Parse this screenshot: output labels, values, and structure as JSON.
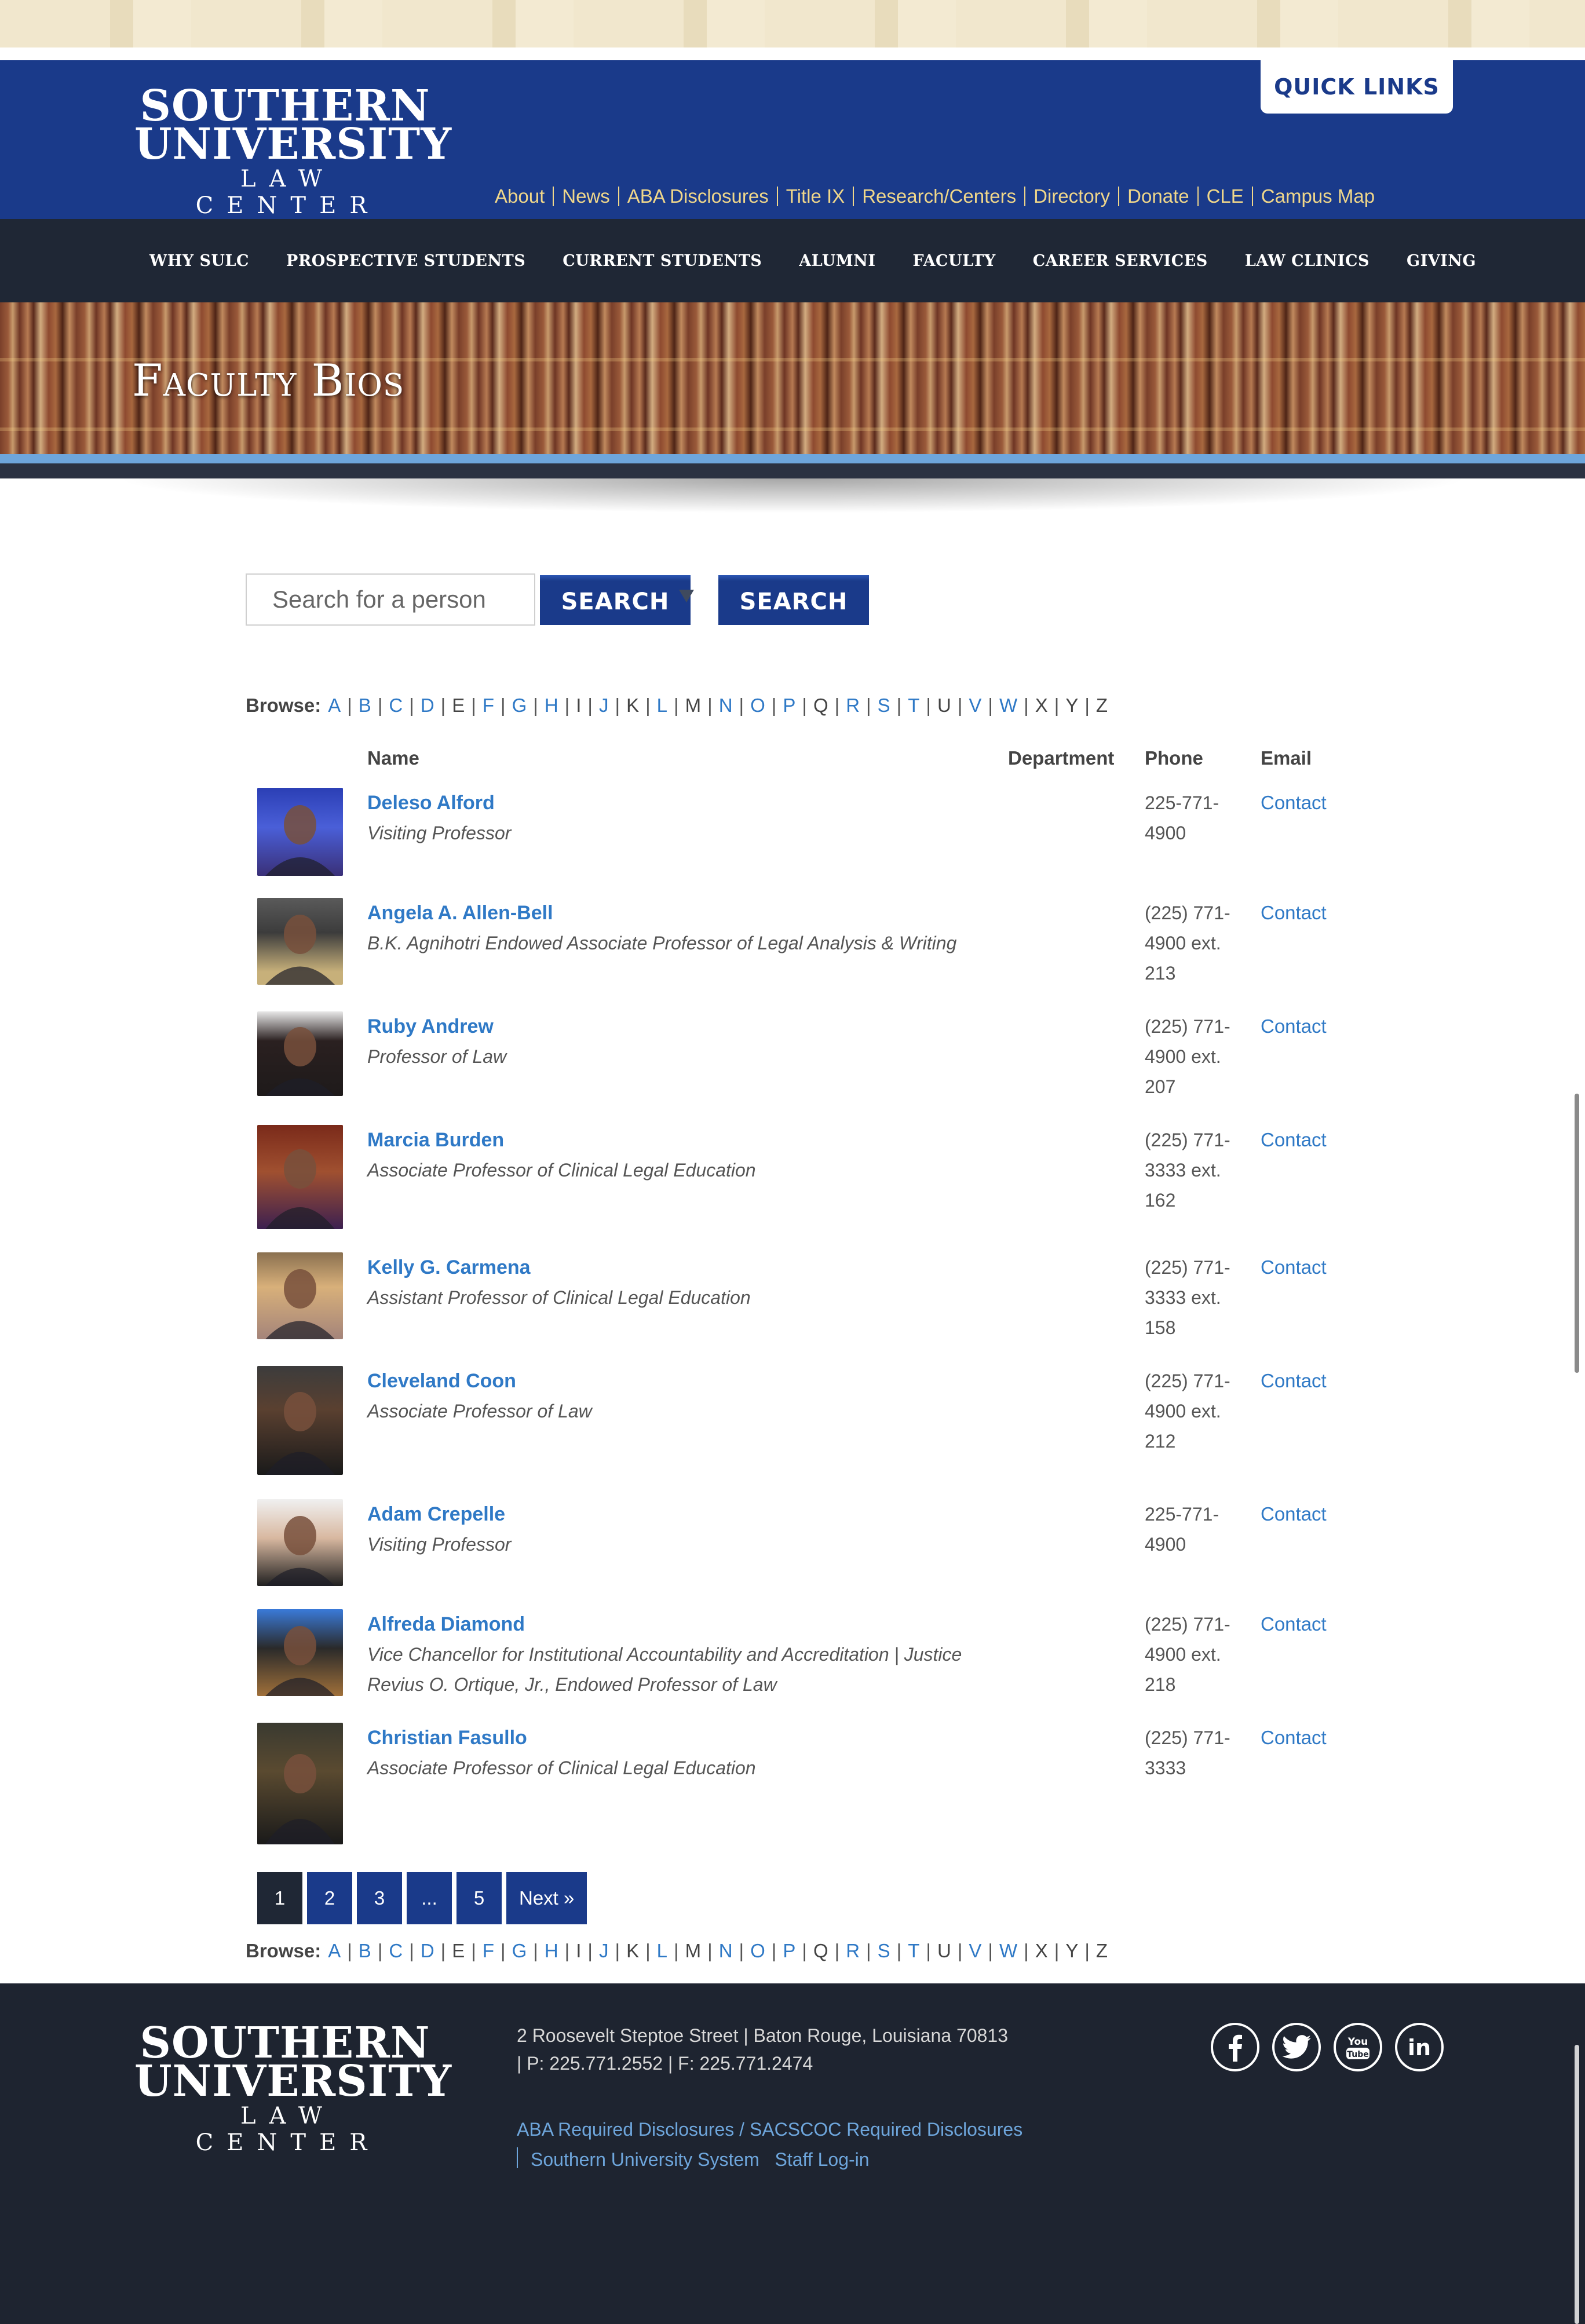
{
  "header": {
    "logo": {
      "line1": "SOUTHERN",
      "line2": "UNIVERSITY",
      "line3": "LAW CENTER"
    },
    "quick_links": "QUICK LINKS",
    "utility_nav": [
      "About",
      "News",
      "ABA Disclosures",
      "Title IX",
      "Research/Centers",
      "Directory",
      "Donate",
      "CLE",
      "Campus Map"
    ]
  },
  "main_nav": [
    "WHY SULC",
    "PROSPECTIVE STUDENTS",
    "CURRENT STUDENTS",
    "ALUMNI",
    "FACULTY",
    "CAREER SERVICES",
    "LAW CLINICS",
    "GIVING"
  ],
  "banner": {
    "title": "Faculty Bios"
  },
  "search": {
    "placeholder": "Search for a person",
    "button1": "SEARCH",
    "button2": "SEARCH"
  },
  "browse": {
    "label": "Browse:",
    "letters": [
      {
        "l": "A",
        "link": true
      },
      {
        "l": "B",
        "link": true
      },
      {
        "l": "C",
        "link": true
      },
      {
        "l": "D",
        "link": true
      },
      {
        "l": "E",
        "link": false
      },
      {
        "l": "F",
        "link": true
      },
      {
        "l": "G",
        "link": true
      },
      {
        "l": "H",
        "link": true
      },
      {
        "l": "I",
        "link": false
      },
      {
        "l": "J",
        "link": true
      },
      {
        "l": "K",
        "link": false
      },
      {
        "l": "L",
        "link": true
      },
      {
        "l": "M",
        "link": false
      },
      {
        "l": "N",
        "link": true
      },
      {
        "l": "O",
        "link": true
      },
      {
        "l": "P",
        "link": true
      },
      {
        "l": "Q",
        "link": false
      },
      {
        "l": "R",
        "link": true
      },
      {
        "l": "S",
        "link": true
      },
      {
        "l": "T",
        "link": true
      },
      {
        "l": "U",
        "link": false
      },
      {
        "l": "V",
        "link": true
      },
      {
        "l": "W",
        "link": true
      },
      {
        "l": "X",
        "link": false
      },
      {
        "l": "Y",
        "link": false
      },
      {
        "l": "Z",
        "link": false
      }
    ]
  },
  "table": {
    "headers": {
      "name": "Name",
      "department": "Department",
      "phone": "Phone",
      "email": "Email"
    },
    "rows": [
      {
        "name": "Deleso Alford",
        "title": "Visiting Professor",
        "phone": "225-771-4900",
        "email": "Contact"
      },
      {
        "name": "Angela A. Allen-Bell",
        "title": "B.K. Agnihotri Endowed Associate Professor of Legal Analysis & Writing",
        "phone": "(225) 771-4900 ext. 213",
        "email": "Contact"
      },
      {
        "name": "Ruby Andrew",
        "title": "Professor of Law",
        "phone": "(225) 771-4900 ext. 207",
        "email": "Contact"
      },
      {
        "name": "Marcia Burden",
        "title": "Associate Professor of Clinical Legal Education",
        "phone": "(225) 771-3333 ext. 162",
        "email": "Contact"
      },
      {
        "name": "Kelly G. Carmena",
        "title": "Assistant Professor of Clinical Legal Education",
        "phone": "(225) 771-3333 ext. 158",
        "email": "Contact"
      },
      {
        "name": "Cleveland Coon",
        "title": "Associate Professor of Law",
        "phone": "(225) 771-4900 ext. 212",
        "email": "Contact"
      },
      {
        "name": "Adam Crepelle",
        "title": "Visiting Professor",
        "phone": "225-771-4900",
        "email": "Contact"
      },
      {
        "name": "Alfreda Diamond",
        "title": "Vice Chancellor for Institutional Accountability and Accreditation | Justice Revius O. Ortique, Jr., Endowed Professor of Law",
        "phone": "(225) 771-4900 ext. 218",
        "email": "Contact"
      },
      {
        "name": "Christian Fasullo",
        "title": "Associate Professor of Clinical Legal Education",
        "phone": "(225) 771-3333",
        "email": "Contact"
      }
    ]
  },
  "pagination": [
    "1",
    "2",
    "3",
    "...",
    "5",
    "Next »"
  ],
  "footer": {
    "address_line1": "2 Roosevelt Steptoe Street  |  Baton Rouge, Louisiana 70813",
    "address_line2": "|  P: 225.771.2552  |  F: 225.771.2474",
    "link1": "ABA Required Disclosures / SACSCOC Required Disclosures",
    "link2": "Southern University System",
    "link3": "Staff Log-in",
    "social": [
      "facebook-icon",
      "twitter-icon",
      "youtube-icon",
      "linkedin-icon"
    ]
  },
  "colors": {
    "brand_blue": "#1a3a8a",
    "nav_dark": "#1f2735",
    "link_blue": "#2f79c6",
    "gold": "#f0d78a"
  }
}
